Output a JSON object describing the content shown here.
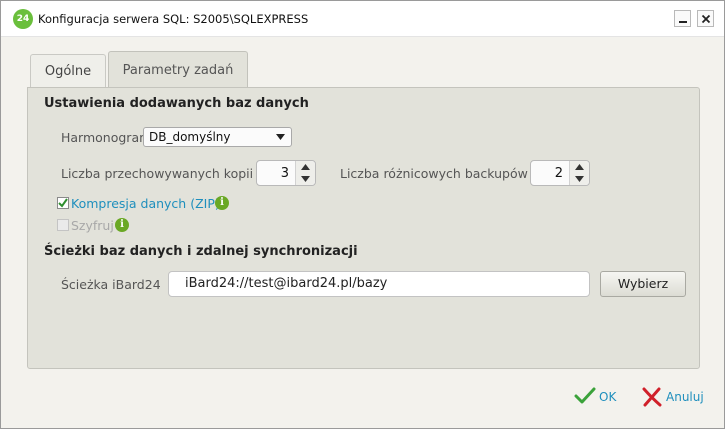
{
  "window": {
    "title": "Konfiguracja serwera SQL: S2005\\SQLEXPRESS",
    "logo_text": "24",
    "minimize_icon": "minimize-icon",
    "close_icon": "close-icon"
  },
  "tabs": [
    {
      "label": "Ogólne",
      "active": false
    },
    {
      "label": "Parametry zadań",
      "active": true
    }
  ],
  "databases_section": {
    "title": "Ustawienia dodawanych baz danych",
    "schedule_label": "Harmonogram",
    "schedule_value": "DB_domyślny",
    "copies_label": "Liczba przechowywanych kopii",
    "copies_value": "3",
    "diff_label": "Liczba różnicowych backupów",
    "diff_value": "2",
    "compression_label": "Kompresja danych (ZIP)",
    "compression_checked": true,
    "encrypt_label": "Szyfruj",
    "encrypt_checked": false,
    "encrypt_enabled": false
  },
  "paths_section": {
    "title": "Ścieżki baz danych i zdalnej synchronizacji",
    "path_label": "Ścieżka iBard24",
    "path_value": "iBard24://test@ibard24.pl/bazy",
    "choose_label": "Wybierz"
  },
  "footer": {
    "ok_label": "OK",
    "cancel_label": "Anuluj"
  },
  "colors": {
    "accent": "#1f8fbd",
    "ok_check": "#3aa23a",
    "cancel_x": "#d0202a",
    "info": "#6aa824",
    "panel": "#e2e2da"
  }
}
